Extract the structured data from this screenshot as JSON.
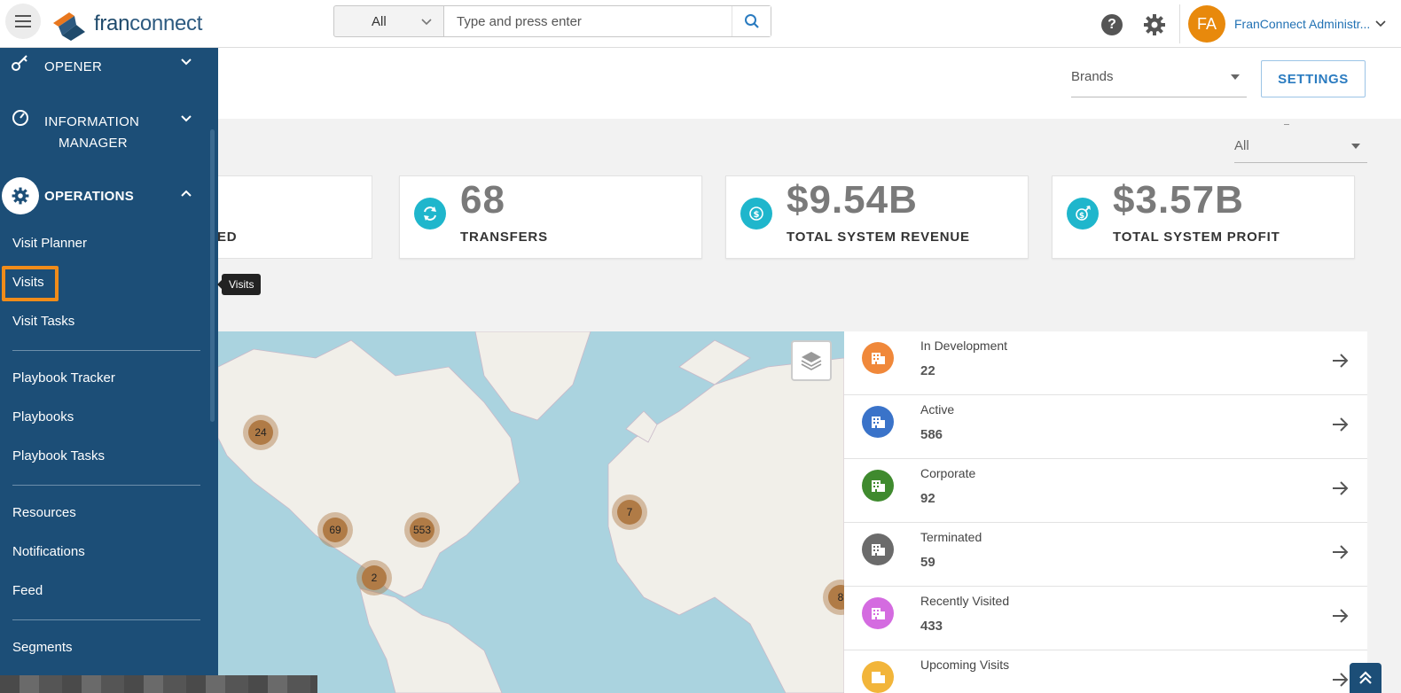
{
  "topbar": {
    "logo_prefix": "fran",
    "logo_suffix": "connect",
    "search_scope": "All",
    "search_placeholder": "Type and press enter",
    "avatar_initials": "FA",
    "user_name": "FranConnect Administr..."
  },
  "sidebar": {
    "groups": [
      {
        "label": "OPENER",
        "icon": "key-icon"
      },
      {
        "label_line1": "INFORMATION",
        "label_line2": "MANAGER",
        "icon": "gauge-icon"
      },
      {
        "label": "OPERATIONS",
        "icon": "gear-icon",
        "expanded": true
      }
    ],
    "items": [
      "Visit Planner",
      "Visits",
      "Visit Tasks",
      "Playbook Tracker",
      "Playbooks",
      "Playbook Tasks",
      "Resources",
      "Notifications",
      "Feed",
      "Segments"
    ],
    "selected": "Visits"
  },
  "tooltip": "Visits",
  "header": {
    "brands_label": "Brands",
    "settings_label": "SETTINGS",
    "filter_value": "All"
  },
  "cards": [
    {
      "value": "",
      "caption": "ED"
    },
    {
      "value": "68",
      "caption": "TRANSFERS",
      "icon": "transfer-icon"
    },
    {
      "value": "$9.54B",
      "caption": "TOTAL SYSTEM REVENUE",
      "icon": "dollar-icon"
    },
    {
      "value": "$3.57B",
      "caption": "TOTAL SYSTEM PROFIT",
      "icon": "profit-icon"
    }
  ],
  "map": {
    "clusters": [
      "24",
      "69",
      "553",
      "2",
      "7",
      "8"
    ]
  },
  "statuses": [
    {
      "label": "In Development",
      "count": "22",
      "color": "#f0883a"
    },
    {
      "label": "Active",
      "count": "586",
      "color": "#3a73c9"
    },
    {
      "label": "Corporate",
      "count": "92",
      "color": "#3f8a2e"
    },
    {
      "label": "Terminated",
      "count": "59",
      "color": "#6b6b6b"
    },
    {
      "label": "Recently Visited",
      "count": "433",
      "color": "#d46be0"
    },
    {
      "label": "Upcoming Visits",
      "count": "",
      "color": "#f2b53a"
    }
  ],
  "colors": {
    "sidebar_bg": "#1c4e77",
    "accent": "#2a7bc0",
    "highlight": "#f08c1a",
    "card_icon": "#1fb6cc"
  }
}
